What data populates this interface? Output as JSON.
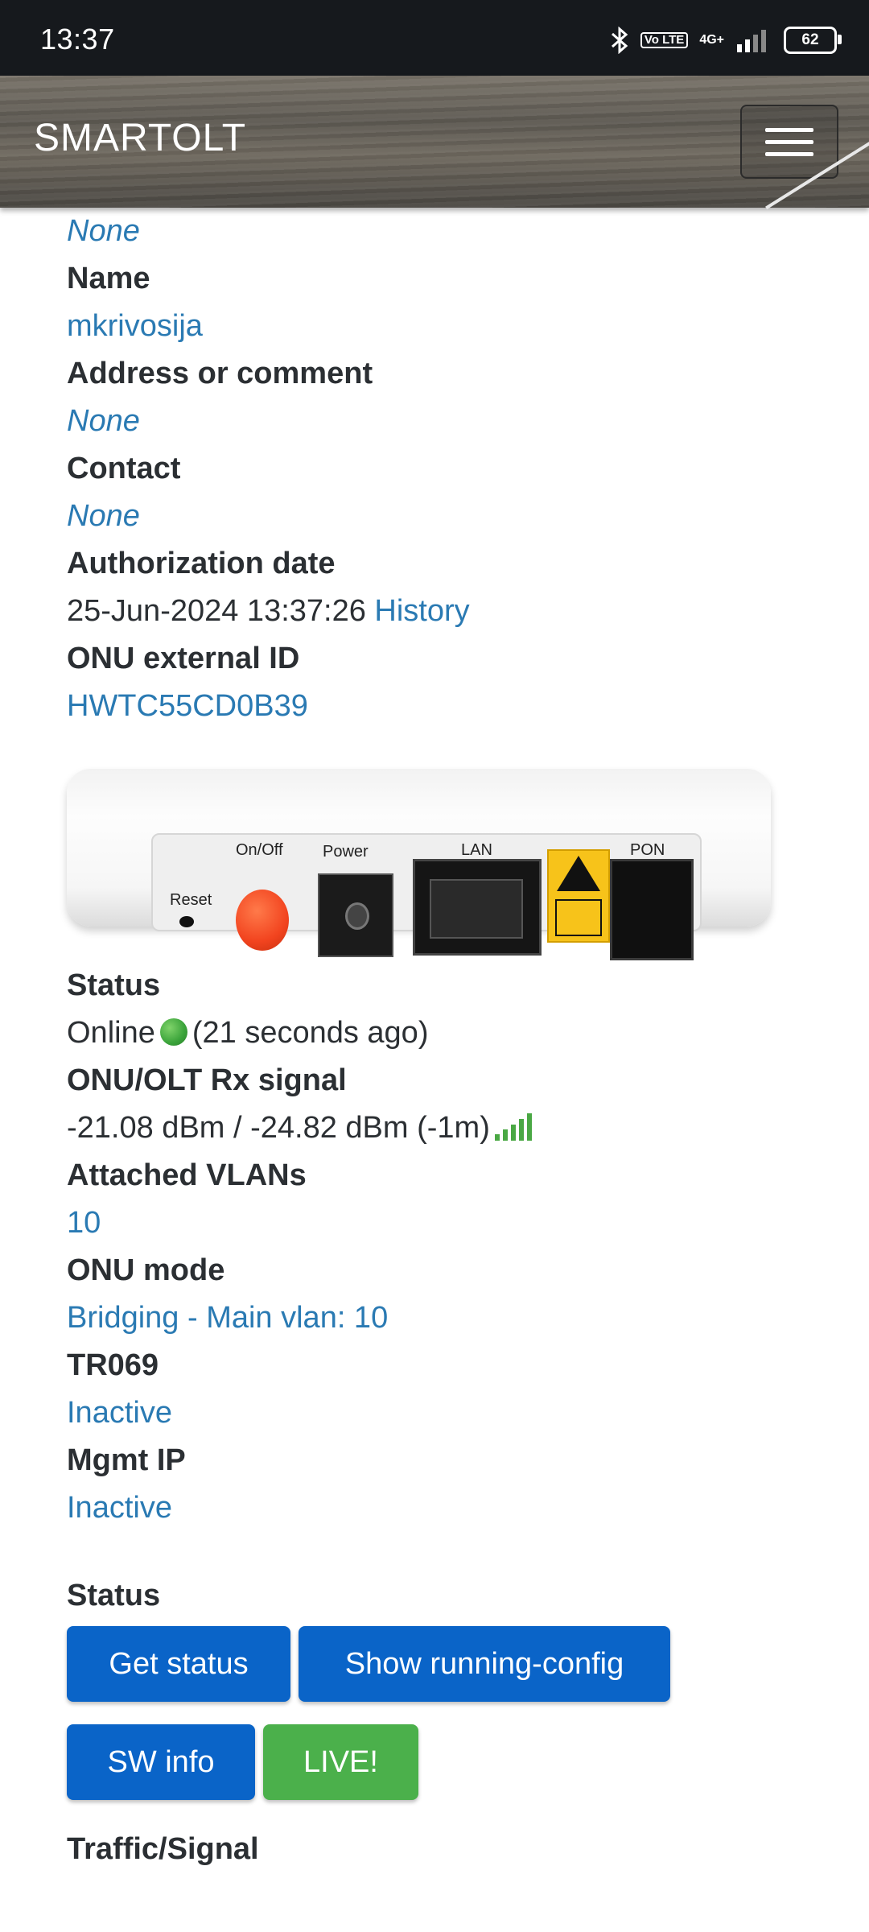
{
  "status_bar": {
    "time": "13:37",
    "icons": [
      "bluetooth-icon",
      "volte-icon",
      "4g-icon",
      "signal-bars-icon",
      "battery-icon"
    ],
    "volte_label": "Vo LTE",
    "network_label": "4G+",
    "battery_level": "62"
  },
  "navbar": {
    "brand": "SMARTOLT",
    "menu_icon": "hamburger-icon"
  },
  "details": {
    "prev_value": "None",
    "name_label": "Name",
    "name_value": "mkrivosija",
    "address_label": "Address or comment",
    "address_value": "None",
    "contact_label": "Contact",
    "contact_value": "None",
    "auth_label": "Authorization date",
    "auth_value": "25-Jun-2024 13:37:26",
    "auth_history_link": "History",
    "external_id_label": "ONU external ID",
    "external_id_value": "HWTC55CD0B39"
  },
  "device_image": {
    "labels": {
      "reset": "Reset",
      "onoff": "On/Off",
      "power": "Power",
      "lan": "LAN",
      "pon": "PON"
    }
  },
  "status_info": {
    "status_label": "Status",
    "status_value": "Online",
    "status_icon": "globe-icon",
    "status_time": "(21 seconds ago)",
    "rx_label": "ONU/OLT Rx signal",
    "rx_value": "-21.08 dBm / -24.82 dBm (-1m)",
    "rx_icon": "signal-strength-icon",
    "vlans_label": "Attached VLANs",
    "vlans_value": "10",
    "mode_label": "ONU mode",
    "mode_value": "Bridging - Main vlan: 10",
    "tr069_label": "TR069",
    "tr069_value": "Inactive",
    "mgmt_label": "Mgmt IP",
    "mgmt_value": "Inactive"
  },
  "actions": {
    "section_title": "Status",
    "get_status": "Get status",
    "show_config": "Show running-config",
    "sw_info": "SW info",
    "live": "LIVE!",
    "next_section_title": "Traffic/Signal",
    "colors": {
      "primary": "#0a64c8",
      "success": "#4bb04b",
      "link": "#2a7ab3"
    }
  }
}
